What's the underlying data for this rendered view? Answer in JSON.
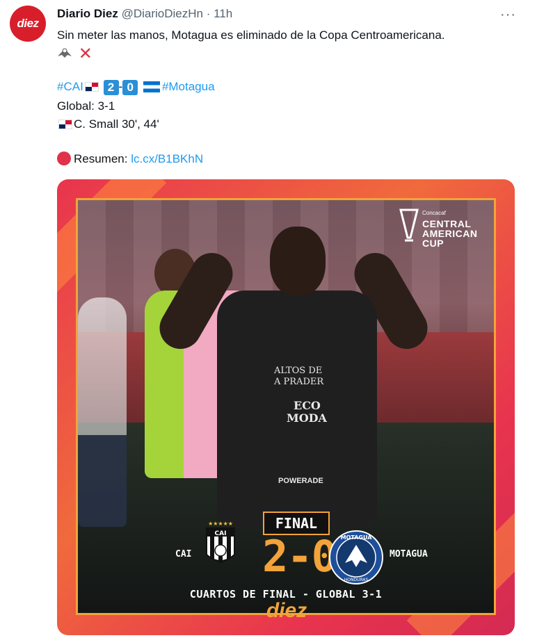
{
  "account": {
    "avatar_text": "diez",
    "name": "Diario Diez",
    "handle": "@DiarioDiezHn",
    "separator": "·",
    "time": "11h",
    "more_icon": "more-horizontal-icon"
  },
  "tweet": {
    "text_line1": "Sin meter las manos, Motagua es eliminado de la Copa Centroamericana.",
    "hashtag_cai": "#CAI",
    "score_home": "2",
    "score_dash": "-",
    "score_away": "0",
    "hashtag_motagua": "#Motagua",
    "global": "Global: 3-1",
    "scorer": "C. Small 30', 44'",
    "summary_label": "Resumen: ",
    "summary_link": "lc.cx/B1BKhN"
  },
  "graphic": {
    "logo_small": "Concacaf",
    "logo_line1": "CENTRAL",
    "logo_line2": "AMERICAN",
    "logo_line3": "CUP",
    "sponsor1": "ALTOS DE",
    "sponsor2": "A PRADER",
    "sponsor3": "ECO",
    "sponsor4": "MODA",
    "sponsor5": "POWERADE",
    "final_label": "FINAL",
    "team_home": "CAI",
    "team_away": "MOTAGUA",
    "score": "2-0",
    "crest_home_text": "CAI",
    "crest_away_text": "MOTAGUA",
    "crest_away_sub": "HONDURAS",
    "subtitle": "CUARTOS DE FINAL - GLOBAL 3-1",
    "brand": "diez"
  },
  "colors": {
    "link": "#1d9bf0",
    "accent_orange": "#f3a33a",
    "brand_red": "#d81e2a"
  }
}
